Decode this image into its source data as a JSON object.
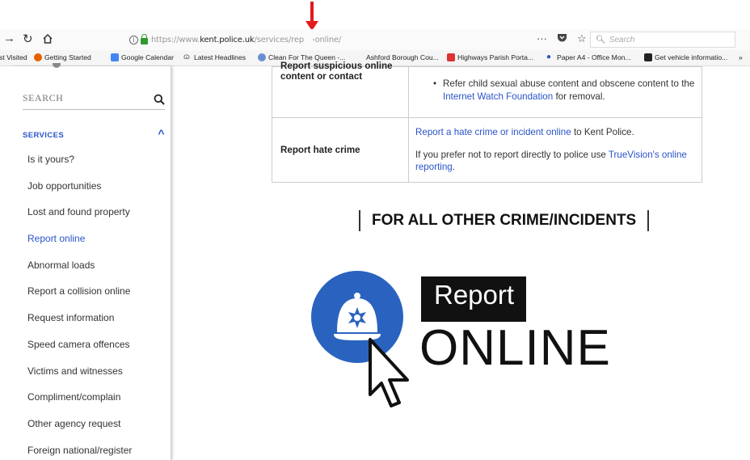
{
  "browser": {
    "url_prefix": "https://www.",
    "url_host": "kent.police.uk",
    "url_path": "/services/rep",
    "url_path_end": "-online/",
    "more_icon": "···",
    "search_placeholder": "Search",
    "bookmarks": [
      {
        "label": "st Visited"
      },
      {
        "label": "Getting Started",
        "icon_color": "#e66000"
      },
      {
        "label": "Google Calendar",
        "icon_color": "#4285f4"
      },
      {
        "label": "Latest Headlines",
        "icon_color": "#555555"
      },
      {
        "label": "Clean For The Queen -...",
        "icon_color": "#6a8fcf"
      },
      {
        "label": "Ashford Borough Cou..."
      },
      {
        "label": "Highways Parish Porta...",
        "icon_color": "#d33"
      },
      {
        "label": "Paper A4 - Office Mon...",
        "icon_color": "#2a54c8"
      },
      {
        "label": "Get vehicle informatio...",
        "icon_color": "#222"
      }
    ]
  },
  "annotation": {
    "arrow_color": "#e21b1b"
  },
  "sidebar": {
    "search_placeholder": "SEARCH",
    "services_label": "SERVICES",
    "items": [
      {
        "label": "Is it yours?"
      },
      {
        "label": "Job opportunities"
      },
      {
        "label": "Lost and found property"
      },
      {
        "label": "Report online",
        "active": true
      },
      {
        "label": "Abnormal loads"
      },
      {
        "label": "Report a collision online"
      },
      {
        "label": "Request information"
      },
      {
        "label": "Speed camera offences"
      },
      {
        "label": "Victims and witnesses"
      },
      {
        "label": "Compliment/complain"
      },
      {
        "label": "Other agency request"
      },
      {
        "label": "Foreign national/register"
      }
    ]
  },
  "table": {
    "row1": {
      "label": "Report suspicious online content or contact",
      "bullet": "Refer child sexual abuse content and obscene content to the",
      "link": "Internet Watch Foundation",
      "after": "for removal."
    },
    "row2": {
      "label": "Report hate crime",
      "link1": "Report a hate crime or incident online",
      "after1": "to Kent Police.",
      "text2": "If you prefer not to report directly to police use",
      "link2": "TrueVision's online reporting",
      "after2": "."
    }
  },
  "main": {
    "other_heading": "FOR ALL OTHER CRIME/INCIDENTS",
    "logo_report": "Report",
    "logo_online": "ONLINE",
    "brand_blue": "#2a63bf",
    "link_color": "#2a54c8"
  }
}
